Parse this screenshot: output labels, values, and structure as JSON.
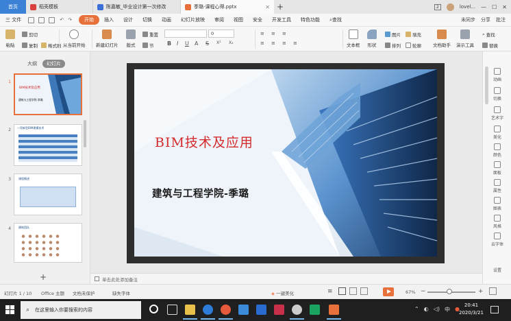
{
  "tabs": [
    {
      "label": "首页",
      "kind": "home"
    },
    {
      "label": "稻壳模板",
      "icon_color": "#d9413f"
    },
    {
      "label": "陈嘉敏_毕业设计第一次修改",
      "icon_color": "#3b6fd6"
    },
    {
      "label": "季璐-课程心得.pptx",
      "icon_color": "#e8703a",
      "active": true
    }
  ],
  "title_right": {
    "page_num": "2",
    "user": "lovel..."
  },
  "menu": {
    "file": "三 文件",
    "items": [
      "开始",
      "插入",
      "设计",
      "切换",
      "动画",
      "幻灯片放映",
      "审阅",
      "视图",
      "安全",
      "开发工具",
      "特色功能"
    ],
    "active": "开始",
    "search": "查找",
    "right": [
      "未同步",
      "分享",
      "批注"
    ]
  },
  "ribbon": {
    "paste": "粘贴",
    "cut": "剪切",
    "copy": "复制",
    "format_painter": "格式刷",
    "play_from_current": "从当前开始",
    "new_slide": "新建幻灯片",
    "layout": "版式",
    "section": "节",
    "reset": "重置",
    "font_size": "0",
    "textbox": "文本框",
    "shape": "形状",
    "arrange": "排列",
    "picture": "图片",
    "fill": "填充",
    "outline": "轮廓",
    "doc_assistant": "文档助手",
    "presentation_tools": "演示工具",
    "find": "查找",
    "replace": "替换"
  },
  "left_panel": {
    "tab_outline": "大纲",
    "tab_slides": "幻灯片",
    "slide_numbers": [
      "1",
      "2",
      "3",
      "4"
    ],
    "thumb1_title": "BIM技术及应用",
    "thumb1_sub": "建筑与工程学院-季璐",
    "thumb2_title": "一项新型BIM建模技术",
    "thumb3_title": "课程概述",
    "thumb4_title": "建筑团队"
  },
  "slide": {
    "title": "BIM技术及应用",
    "subtitle": "建筑与工程学院-季璐",
    "accent_color": "#d42a2a"
  },
  "notes_placeholder": "单击此处添加备注",
  "right_panel": [
    "动画",
    "切换",
    "艺术字",
    "美化",
    "颜色",
    "面板",
    "属性",
    "图表",
    "风格",
    "云字体",
    "设置"
  ],
  "status": {
    "slide_counter": "幻灯片 1 / 10",
    "theme": "Office 主题",
    "doc_protect": "文档未保护",
    "missing_font": "缺失字体",
    "beautify": "一键美化",
    "zoom": "67%",
    "zoom_fraction": 0.45
  },
  "taskbar": {
    "search_placeholder": "在这里输入你要搜索的内容",
    "time": "20:41",
    "date": "2020/3/21",
    "ime": "中"
  }
}
